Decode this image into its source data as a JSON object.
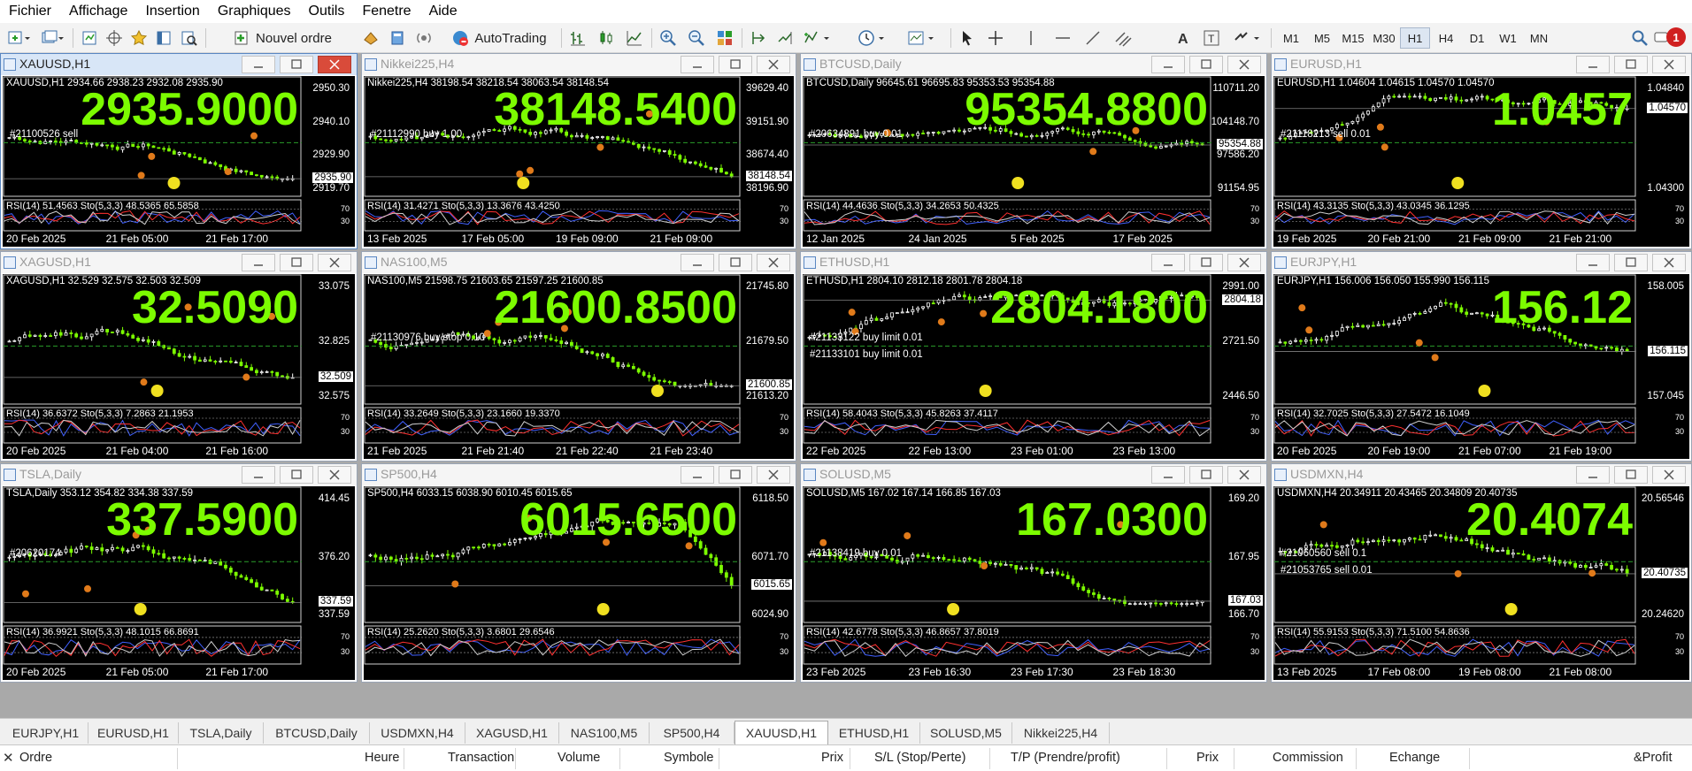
{
  "menu": [
    "Fichier",
    "Affichage",
    "Insertion",
    "Graphiques",
    "Outils",
    "Fenetre",
    "Aide"
  ],
  "toolbar": {
    "new_order": "Nouvel ordre",
    "autotrading": "AutoTrading",
    "timeframes": [
      "M1",
      "M5",
      "M15",
      "M30",
      "H1",
      "H4",
      "D1",
      "W1",
      "MN"
    ],
    "active_timeframe": "H1",
    "notifications": "1"
  },
  "charts": [
    {
      "title": "XAUUSD,H1",
      "ohlc": "XAUUSD,H1  2934.66 2938.23 2932.08 2935.90",
      "price": "2935.9000",
      "yticks": [
        "2950.30",
        "2940.10",
        "2929.90",
        "2919.70"
      ],
      "current": "2935.90",
      "order": "#21100526 sell",
      "xlabels": [
        "20 Feb 2025",
        "21 Feb 05:00",
        "21 Feb 17:00"
      ],
      "rsi": "RSI(14) 51.4563  Sto(5,3,3) 48.5365 65.5858",
      "active": true,
      "trend": "down"
    },
    {
      "title": "Nikkei225,H4",
      "ohlc": "Nikkei225,H4  38198.54 38218.54 38063.54 38148.54",
      "price": "38148.5400",
      "yticks": [
        "39629.40",
        "39151.90",
        "38674.40",
        "38196.90"
      ],
      "current": "38148.54",
      "order": "#21112990 buy 1.00",
      "xlabels": [
        "13 Feb 2025",
        "17 Feb 05:00",
        "19 Feb 09:00",
        "21 Feb 09:00"
      ],
      "rsi": "RSI(14) 31.4271  Sto(5,3,3) 13.3676 43.4250",
      "trend": "down"
    },
    {
      "title": "BTCUSD,Daily",
      "ohlc": "BTCUSD,Daily  96645.61 96695.83 95353.53 95354.88",
      "price": "95354.8800",
      "yticks": [
        "110711.20",
        "104148.70",
        "97586.20",
        "91154.95"
      ],
      "current": "95354.88",
      "order": "#20634891 buy 0.01",
      "xlabels": [
        "12 Jan 2025",
        "24 Jan 2025",
        "5 Feb 2025",
        "17 Feb 2025"
      ],
      "rsi": "RSI(14) 44.4636  Sto(5,3,3) 34.2653 50.4325",
      "trend": "flat"
    },
    {
      "title": "EURUSD,H1",
      "ohlc": "EURUSD,H1  1.04604 1.04615 1.04570 1.04570",
      "price": "1.0457",
      "yticks": [
        "1.04840",
        "1.04300"
      ],
      "current": "1.04570",
      "order": "#21118213 sell 0.01",
      "xlabels": [
        "19 Feb 2025",
        "20 Feb 21:00",
        "21 Feb 09:00",
        "21 Feb 21:00"
      ],
      "rsi": "RSI(14) 43.3135  Sto(5,3,3) 43.0345 36.1295",
      "trend": "up"
    },
    {
      "title": "XAGUSD,H1",
      "ohlc": "XAGUSD,H1  32.529 32.575 32.503 32.509",
      "price": "32.5090",
      "yticks": [
        "33.075",
        "32.825",
        "32.575"
      ],
      "current": "32.509",
      "order": "",
      "xlabels": [
        "20 Feb 2025",
        "21 Feb 04:00",
        "21 Feb 16:00"
      ],
      "rsi": "RSI(14) 36.6372  Sto(5,3,3) 7.2863 21.1953",
      "trend": "down"
    },
    {
      "title": "NAS100,M5",
      "ohlc": "NAS100,M5  21598.75 21603.65 21597.25 21600.85",
      "price": "21600.8500",
      "yticks": [
        "21745.80",
        "21679.50",
        "21613.20"
      ],
      "current": "21600.85",
      "order": "#21130976 buy stop 0.10",
      "xlabels": [
        "21 Feb 2025",
        "21 Feb 21:40",
        "21 Feb 22:40",
        "21 Feb 23:40"
      ],
      "rsi": "RSI(14) 33.2649  Sto(5,3,3) 23.1660 19.3370",
      "trend": "down"
    },
    {
      "title": "ETHUSD,H1",
      "ohlc": "ETHUSD,H1  2804.10 2812.18 2801.78 2804.18",
      "price": "2804.1800",
      "yticks": [
        "2991.00",
        "2721.50",
        "2446.50"
      ],
      "current": "2804.18",
      "order": "#21133122 buy limit 0.01",
      "order2": "#21133101 buy limit 0.01",
      "xlabels": [
        "22 Feb 2025",
        "22 Feb 13:00",
        "23 Feb 01:00",
        "23 Feb 13:00"
      ],
      "rsi": "RSI(14) 58.4043  Sto(5,3,3) 45.8263 37.4117",
      "trend": "flatup"
    },
    {
      "title": "EURJPY,H1",
      "ohlc": "EURJPY,H1  156.006 156.050 155.990 156.115",
      "price": "156.12",
      "yticks": [
        "158.005",
        "157.045"
      ],
      "current": "156.115",
      "order": "",
      "xlabels": [
        "20 Feb 2025",
        "20 Feb 19:00",
        "21 Feb 07:00",
        "21 Feb 19:00"
      ],
      "rsi": "RSI(14) 32.7025  Sto(5,3,3) 27.5472 16.1049",
      "trend": "updown"
    },
    {
      "title": "TSLA,Daily",
      "ohlc": "TSLA,Daily  353.12 354.82 334.38 337.59",
      "price": "337.5900",
      "yticks": [
        "414.45",
        "376.20",
        "337.59"
      ],
      "current": "337.59",
      "order": "#20620174",
      "xlabels": [
        "20 Feb 2025",
        "21 Feb 05:00",
        "21 Feb 17:00"
      ],
      "rsi": "RSI(14) 36.9921  Sto(5,3,3) 48.1015 66.8691",
      "trend": "down"
    },
    {
      "title": "SP500,H4",
      "ohlc": "SP500,H4  6033.15 6038.90 6010.45 6015.65",
      "price": "6015.6500",
      "yticks": [
        "6118.50",
        "6071.70",
        "6024.90"
      ],
      "current": "6015.65",
      "order": "",
      "xlabels": [],
      "rsi": "RSI(14) 25.2620  Sto(5,3,3) 3.6801 29.6546",
      "trend": "updrop"
    },
    {
      "title": "SOLUSD,M5",
      "ohlc": "SOLUSD,M5  167.02 167.14 166.85 167.03",
      "price": "167.0300",
      "yticks": [
        "169.20",
        "167.95",
        "166.70"
      ],
      "current": "167.03",
      "order": "#21138419 buy 0.01",
      "xlabels": [
        "23 Feb 2025",
        "23 Feb 16:30",
        "23 Feb 17:30",
        "23 Feb 18:30"
      ],
      "rsi": "RSI(14) 42.6778  Sto(5,3,3) 46.8657 37.8019",
      "trend": "down"
    },
    {
      "title": "USDMXN,H4",
      "ohlc": "USDMXN,H4  20.34911 20.43465 20.34809 20.40735",
      "price": "20.4074",
      "yticks": [
        "20.56546",
        "20.24620"
      ],
      "current": "20.40735",
      "order": "#21060560 sell 0.1",
      "order2": "#21053765 sell 0.01",
      "xlabels": [
        "13 Feb 2025",
        "17 Feb 08:00",
        "19 Feb 08:00",
        "21 Feb 08:00"
      ],
      "rsi": "RSI(14) 55.9153  Sto(5,3,3) 71.5100 54.8636",
      "trend": "updown"
    }
  ],
  "tabs": [
    "EURJPY,H1",
    "EURUSD,H1",
    "TSLA,Daily",
    "BTCUSD,Daily",
    "USDMXN,H4",
    "XAGUSD,H1",
    "NAS100,M5",
    "SP500,H4",
    "XAUUSD,H1",
    "ETHUSD,H1",
    "SOLUSD,M5",
    "Nikkei225,H4"
  ],
  "active_tab": "XAUUSD,H1",
  "terminal_columns": [
    "Ordre",
    "Heure",
    "Transaction",
    "Volume",
    "Symbole",
    "Prix",
    "S/L (Stop/Perte)",
    "T/P (Prendre/profit)",
    "Prix",
    "Commission",
    "Echange",
    "&Profit"
  ],
  "colors": {
    "price": "#7cfc00",
    "bull": "#ffffff",
    "bear": "#7cfc00",
    "background": "#000000"
  }
}
